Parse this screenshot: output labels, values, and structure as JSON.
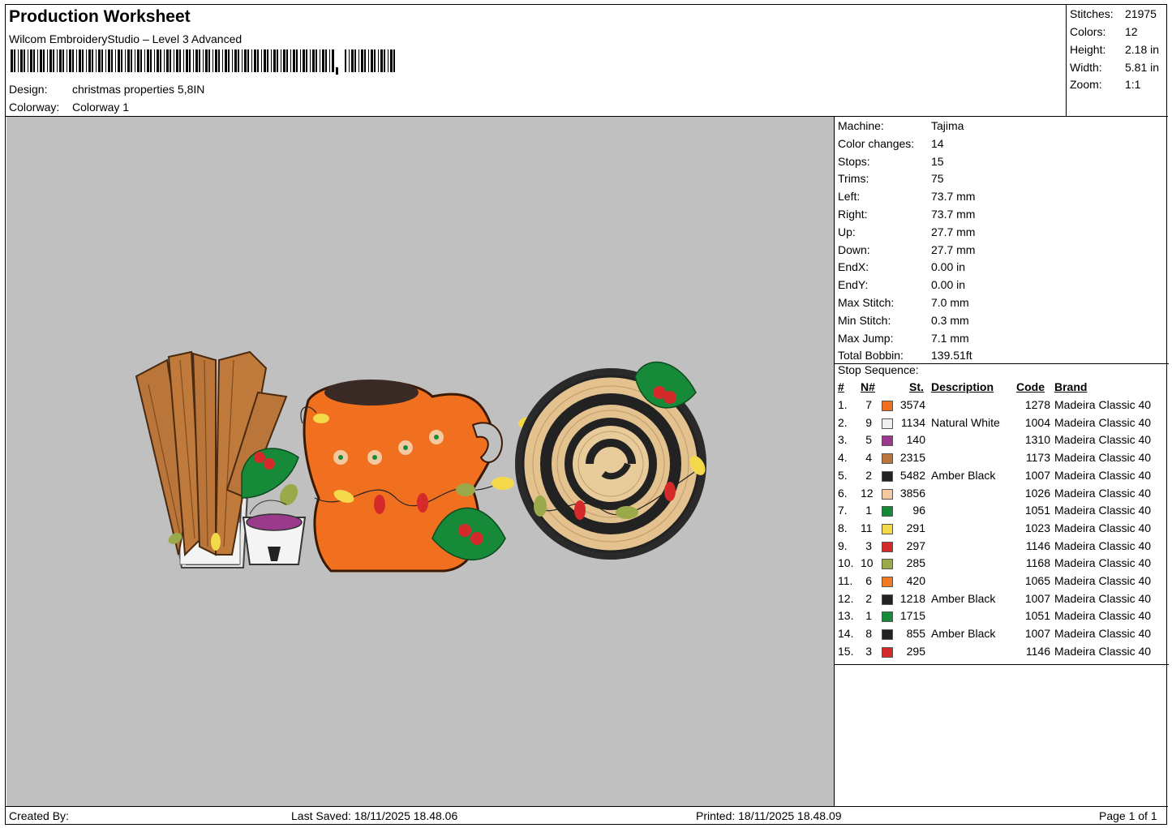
{
  "header": {
    "title": "Production Worksheet",
    "software": "Wilcom EmbroideryStudio – Level 3 Advanced",
    "design_label": "Design:",
    "design_value": "christmas properties 5,8IN",
    "colorway_label": "Colorway:",
    "colorway_value": "Colorway 1",
    "stats": [
      {
        "label": "Stitches:",
        "value": "21975"
      },
      {
        "label": "Colors:",
        "value": "12"
      },
      {
        "label": "Height:",
        "value": "2.18 in"
      },
      {
        "label": "Width:",
        "value": "5.81 in"
      },
      {
        "label": "Zoom:",
        "value": "1:1"
      }
    ]
  },
  "machine_stats": [
    {
      "label": "Machine:",
      "value": "Tajima"
    },
    {
      "label": "Color changes:",
      "value": "14"
    },
    {
      "label": "Stops:",
      "value": "15"
    },
    {
      "label": "Trims:",
      "value": "75"
    },
    {
      "label": "Left:",
      "value": "73.7 mm"
    },
    {
      "label": "Right:",
      "value": "73.7 mm"
    },
    {
      "label": "Up:",
      "value": "27.7 mm"
    },
    {
      "label": "Down:",
      "value": "27.7 mm"
    },
    {
      "label": "EndX:",
      "value": "0.00 in"
    },
    {
      "label": "EndY:",
      "value": "0.00 in"
    },
    {
      "label": "Max Stitch:",
      "value": "7.0 mm"
    },
    {
      "label": "Min Stitch:",
      "value": "0.3 mm"
    },
    {
      "label": "Max Jump:",
      "value": "7.1 mm"
    },
    {
      "label": "Total Bobbin:",
      "value": "139.51ft"
    }
  ],
  "stop_sequence": {
    "title": "Stop Sequence:",
    "headers": {
      "num": "#",
      "n": "N#",
      "st": "St.",
      "description": "Description",
      "code": "Code",
      "brand": "Brand"
    },
    "rows": [
      {
        "num": "1.",
        "n": "7",
        "color": "#f07020",
        "st": "3574",
        "description": "",
        "code": "1278",
        "brand": "Madeira Classic 40"
      },
      {
        "num": "2.",
        "n": "9",
        "color": "#eeeeee",
        "st": "1134",
        "description": "Natural White",
        "code": "1004",
        "brand": "Madeira Classic 40"
      },
      {
        "num": "3.",
        "n": "5",
        "color": "#9a3a8a",
        "st": "140",
        "description": "",
        "code": "1310",
        "brand": "Madeira Classic 40"
      },
      {
        "num": "4.",
        "n": "4",
        "color": "#b9753a",
        "st": "2315",
        "description": "",
        "code": "1173",
        "brand": "Madeira Classic 40"
      },
      {
        "num": "5.",
        "n": "2",
        "color": "#222222",
        "st": "5482",
        "description": "Amber Black",
        "code": "1007",
        "brand": "Madeira Classic 40"
      },
      {
        "num": "6.",
        "n": "12",
        "color": "#f2c9a0",
        "st": "3856",
        "description": "",
        "code": "1026",
        "brand": "Madeira Classic 40"
      },
      {
        "num": "7.",
        "n": "1",
        "color": "#178a3a",
        "st": "96",
        "description": "",
        "code": "1051",
        "brand": "Madeira Classic 40"
      },
      {
        "num": "8.",
        "n": "11",
        "color": "#f3d84a",
        "st": "291",
        "description": "",
        "code": "1023",
        "brand": "Madeira Classic 40"
      },
      {
        "num": "9.",
        "n": "3",
        "color": "#d42a2a",
        "st": "297",
        "description": "",
        "code": "1146",
        "brand": "Madeira Classic 40"
      },
      {
        "num": "10.",
        "n": "10",
        "color": "#9aaa4a",
        "st": "285",
        "description": "",
        "code": "1168",
        "brand": "Madeira Classic 40"
      },
      {
        "num": "11.",
        "n": "6",
        "color": "#f07a22",
        "st": "420",
        "description": "",
        "code": "1065",
        "brand": "Madeira Classic 40"
      },
      {
        "num": "12.",
        "n": "2",
        "color": "#222222",
        "st": "1218",
        "description": "Amber Black",
        "code": "1007",
        "brand": "Madeira Classic 40"
      },
      {
        "num": "13.",
        "n": "1",
        "color": "#178a3a",
        "st": "1715",
        "description": "",
        "code": "1051",
        "brand": "Madeira Classic 40"
      },
      {
        "num": "14.",
        "n": "8",
        "color": "#222222",
        "st": "855",
        "description": "Amber Black",
        "code": "1007",
        "brand": "Madeira Classic 40"
      },
      {
        "num": "15.",
        "n": "3",
        "color": "#d42a2a",
        "st": "295",
        "description": "",
        "code": "1146",
        "brand": "Madeira Classic 40"
      }
    ]
  },
  "footer": {
    "created_by": "Created By:",
    "last_saved": "Last Saved: 18/11/2025 18.48.06",
    "printed": "Printed: 18/11/2025 18.48.09",
    "page": "Page 1 of 1"
  },
  "colors": {
    "canvas_background": "#c0c0c0"
  }
}
